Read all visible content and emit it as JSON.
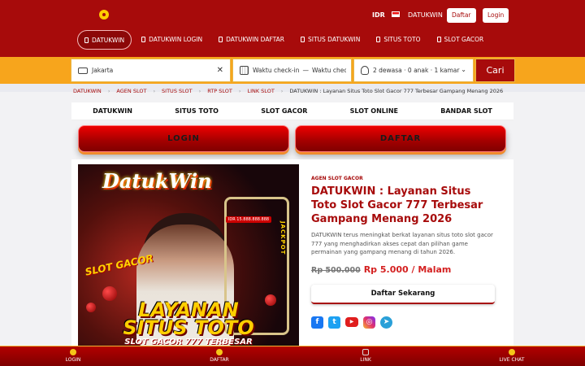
{
  "header": {
    "currency": "IDR",
    "brand": "DATUKWIN",
    "daftar_label": "Daftar",
    "login_label": "Login"
  },
  "nav": {
    "items": [
      {
        "label": "DATUKWIN"
      },
      {
        "label": "DATUKWIN LOGIN"
      },
      {
        "label": "DATUKWIN DAFTAR"
      },
      {
        "label": "SITUS DATUKWIN"
      },
      {
        "label": "SITUS TOTO"
      },
      {
        "label": "SLOT GACOR"
      }
    ]
  },
  "search": {
    "location_value": "Jakarta",
    "checkin_placeholder": "Waktu check-in",
    "separator": "—",
    "checkout_placeholder": "Waktu check-out",
    "guests": "2 dewasa · 0 anak · 1 kamar",
    "button_label": "Cari"
  },
  "breadcrumb": {
    "items": [
      "DATUKWIN",
      "AGEN SLOT",
      "SITUS SLOT",
      "RTP SLOT",
      "LINK SLOT"
    ],
    "current": "DATUKWIN : Layanan Situs Toto Slot Gacor 777 Terbesar Gampang Menang 2026"
  },
  "subnav": {
    "items": [
      "DATUKWIN",
      "SITUS TOTO",
      "SLOT GACOR",
      "SLOT ONLINE",
      "BANDAR SLOT"
    ]
  },
  "big_buttons": {
    "login": "LOGIN",
    "daftar": "DAFTAR"
  },
  "banner": {
    "logo_text": "DatukWin",
    "slot_gacor": "SLOT GACOR",
    "jackpot_badge": "IDR 15.888.888.888",
    "jackpot": "JACKPOT",
    "headline_1": "LAYANAN",
    "headline_2": "SITUS TOTO",
    "subline": "SLOT GACOR 777 TERBESAR"
  },
  "product": {
    "tag": "AGEN SLOT GACOR",
    "title": "DATUKWIN : Layanan Situs Toto Slot Gacor 777 Terbesar Gampang Menang 2026",
    "description": "DATUKWIN terus meningkat berkat layanan situs toto slot gacor 777 yang menghadirkan akses cepat dan pilihan game permainan yang gampang menang di tahun 2026.",
    "old_price": "Rp 500.000",
    "new_price": "Rp 5.000 / Malam",
    "cta_label": "Daftar Sekarang",
    "socials": [
      "facebook-icon",
      "twitter-icon",
      "youtube-icon",
      "instagram-icon",
      "telegram-icon"
    ]
  },
  "bottom_bar": {
    "items": [
      {
        "label": "LOGIN",
        "icon": "coin-icon"
      },
      {
        "label": "DAFTAR",
        "icon": "user-icon"
      },
      {
        "label": "LINK",
        "icon": "link-icon"
      },
      {
        "label": "LIVE CHAT",
        "icon": "chat-icon"
      }
    ]
  },
  "colors": {
    "primary": "#a70b0b",
    "accent": "#f7a51c",
    "price": "#d42020"
  }
}
